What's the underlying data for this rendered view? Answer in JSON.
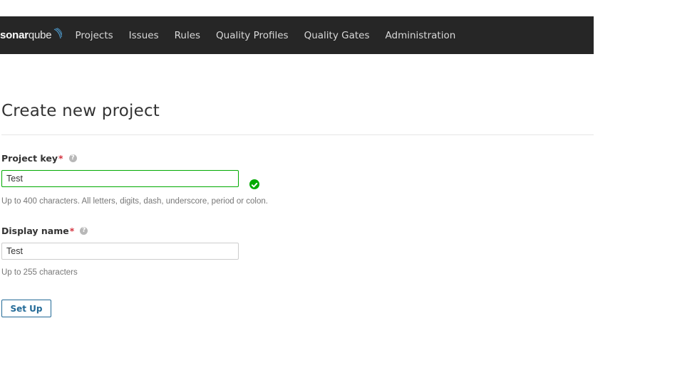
{
  "navbar": {
    "logo_bold": "sonar",
    "logo_light": "qube",
    "items": [
      {
        "label": "Projects"
      },
      {
        "label": "Issues"
      },
      {
        "label": "Rules"
      },
      {
        "label": "Quality Profiles"
      },
      {
        "label": "Quality Gates"
      },
      {
        "label": "Administration"
      }
    ]
  },
  "page": {
    "title": "Create new project"
  },
  "form": {
    "project_key": {
      "label": "Project key",
      "required_mark": "*",
      "value": "Test",
      "valid": true,
      "hint": "Up to 400 characters. All letters, digits, dash, underscore, period or colon."
    },
    "display_name": {
      "label": "Display name",
      "required_mark": "*",
      "value": "Test",
      "hint": "Up to 255 characters"
    },
    "submit_label": "Set Up"
  },
  "colors": {
    "navbar_bg": "#262626",
    "valid_green": "#00aa00",
    "button_blue": "#236a97",
    "required_red": "#d4333f"
  }
}
